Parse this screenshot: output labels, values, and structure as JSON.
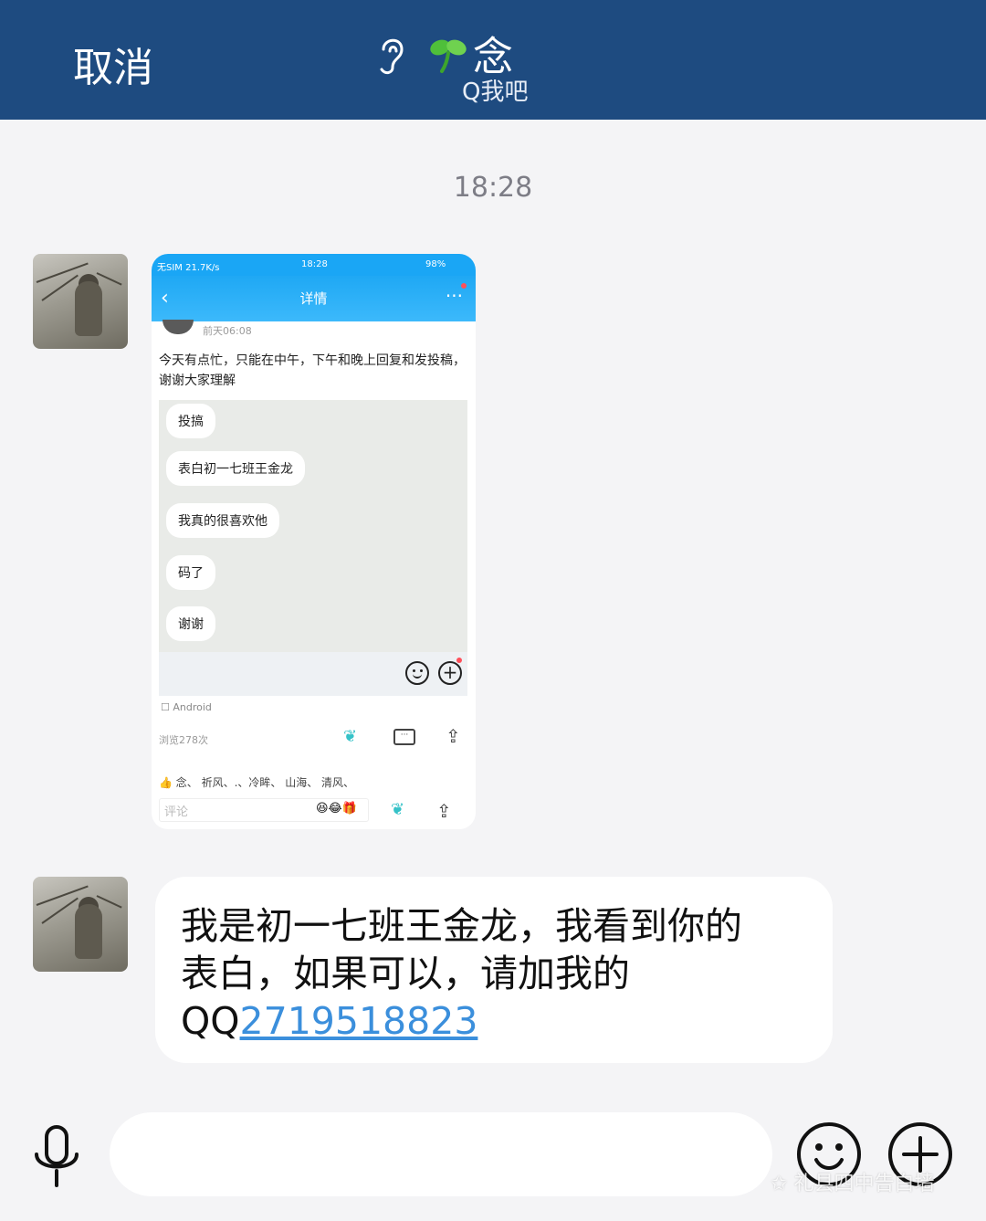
{
  "header": {
    "cancel_label": "取消",
    "contact_name": "念",
    "contact_status": "Q我吧",
    "icons": [
      "ear-icon",
      "sprout-icon"
    ]
  },
  "chat": {
    "timestamp": "18:28",
    "image_message": {
      "status_left": "无SIM 21.7K/s",
      "status_time": "18:28",
      "status_right": "98%",
      "nav_title": "详情",
      "post_date": "前天06:08",
      "post_text": "今天有点忙，只能在中午，下午和晚上回复和发投稿，谢谢大家理解",
      "chat_bubbles": [
        "投搞",
        "表白初一七班王金龙",
        "我真的很喜欢他",
        "码了",
        "谢谢"
      ],
      "device": "Android",
      "views": "浏览278次",
      "likers": "念、 祈风、.、冷眸、 山海、 清风、",
      "comment_placeholder": "评论"
    },
    "text_message": {
      "text": "我是初一七班王金龙，我看到你的表白，如果可以，请加我的QQ",
      "qq_number": "2719518823"
    }
  },
  "bottom_bar": {
    "icons": [
      "microphone-icon",
      "smile-icon",
      "plus-icon"
    ],
    "watermark": "礼县四中告白墙"
  },
  "colors": {
    "header_bg": "#1e4b80",
    "page_bg": "#f4f4f6",
    "link": "#3b8fdc",
    "qq_blue": "#1aa6f5"
  }
}
